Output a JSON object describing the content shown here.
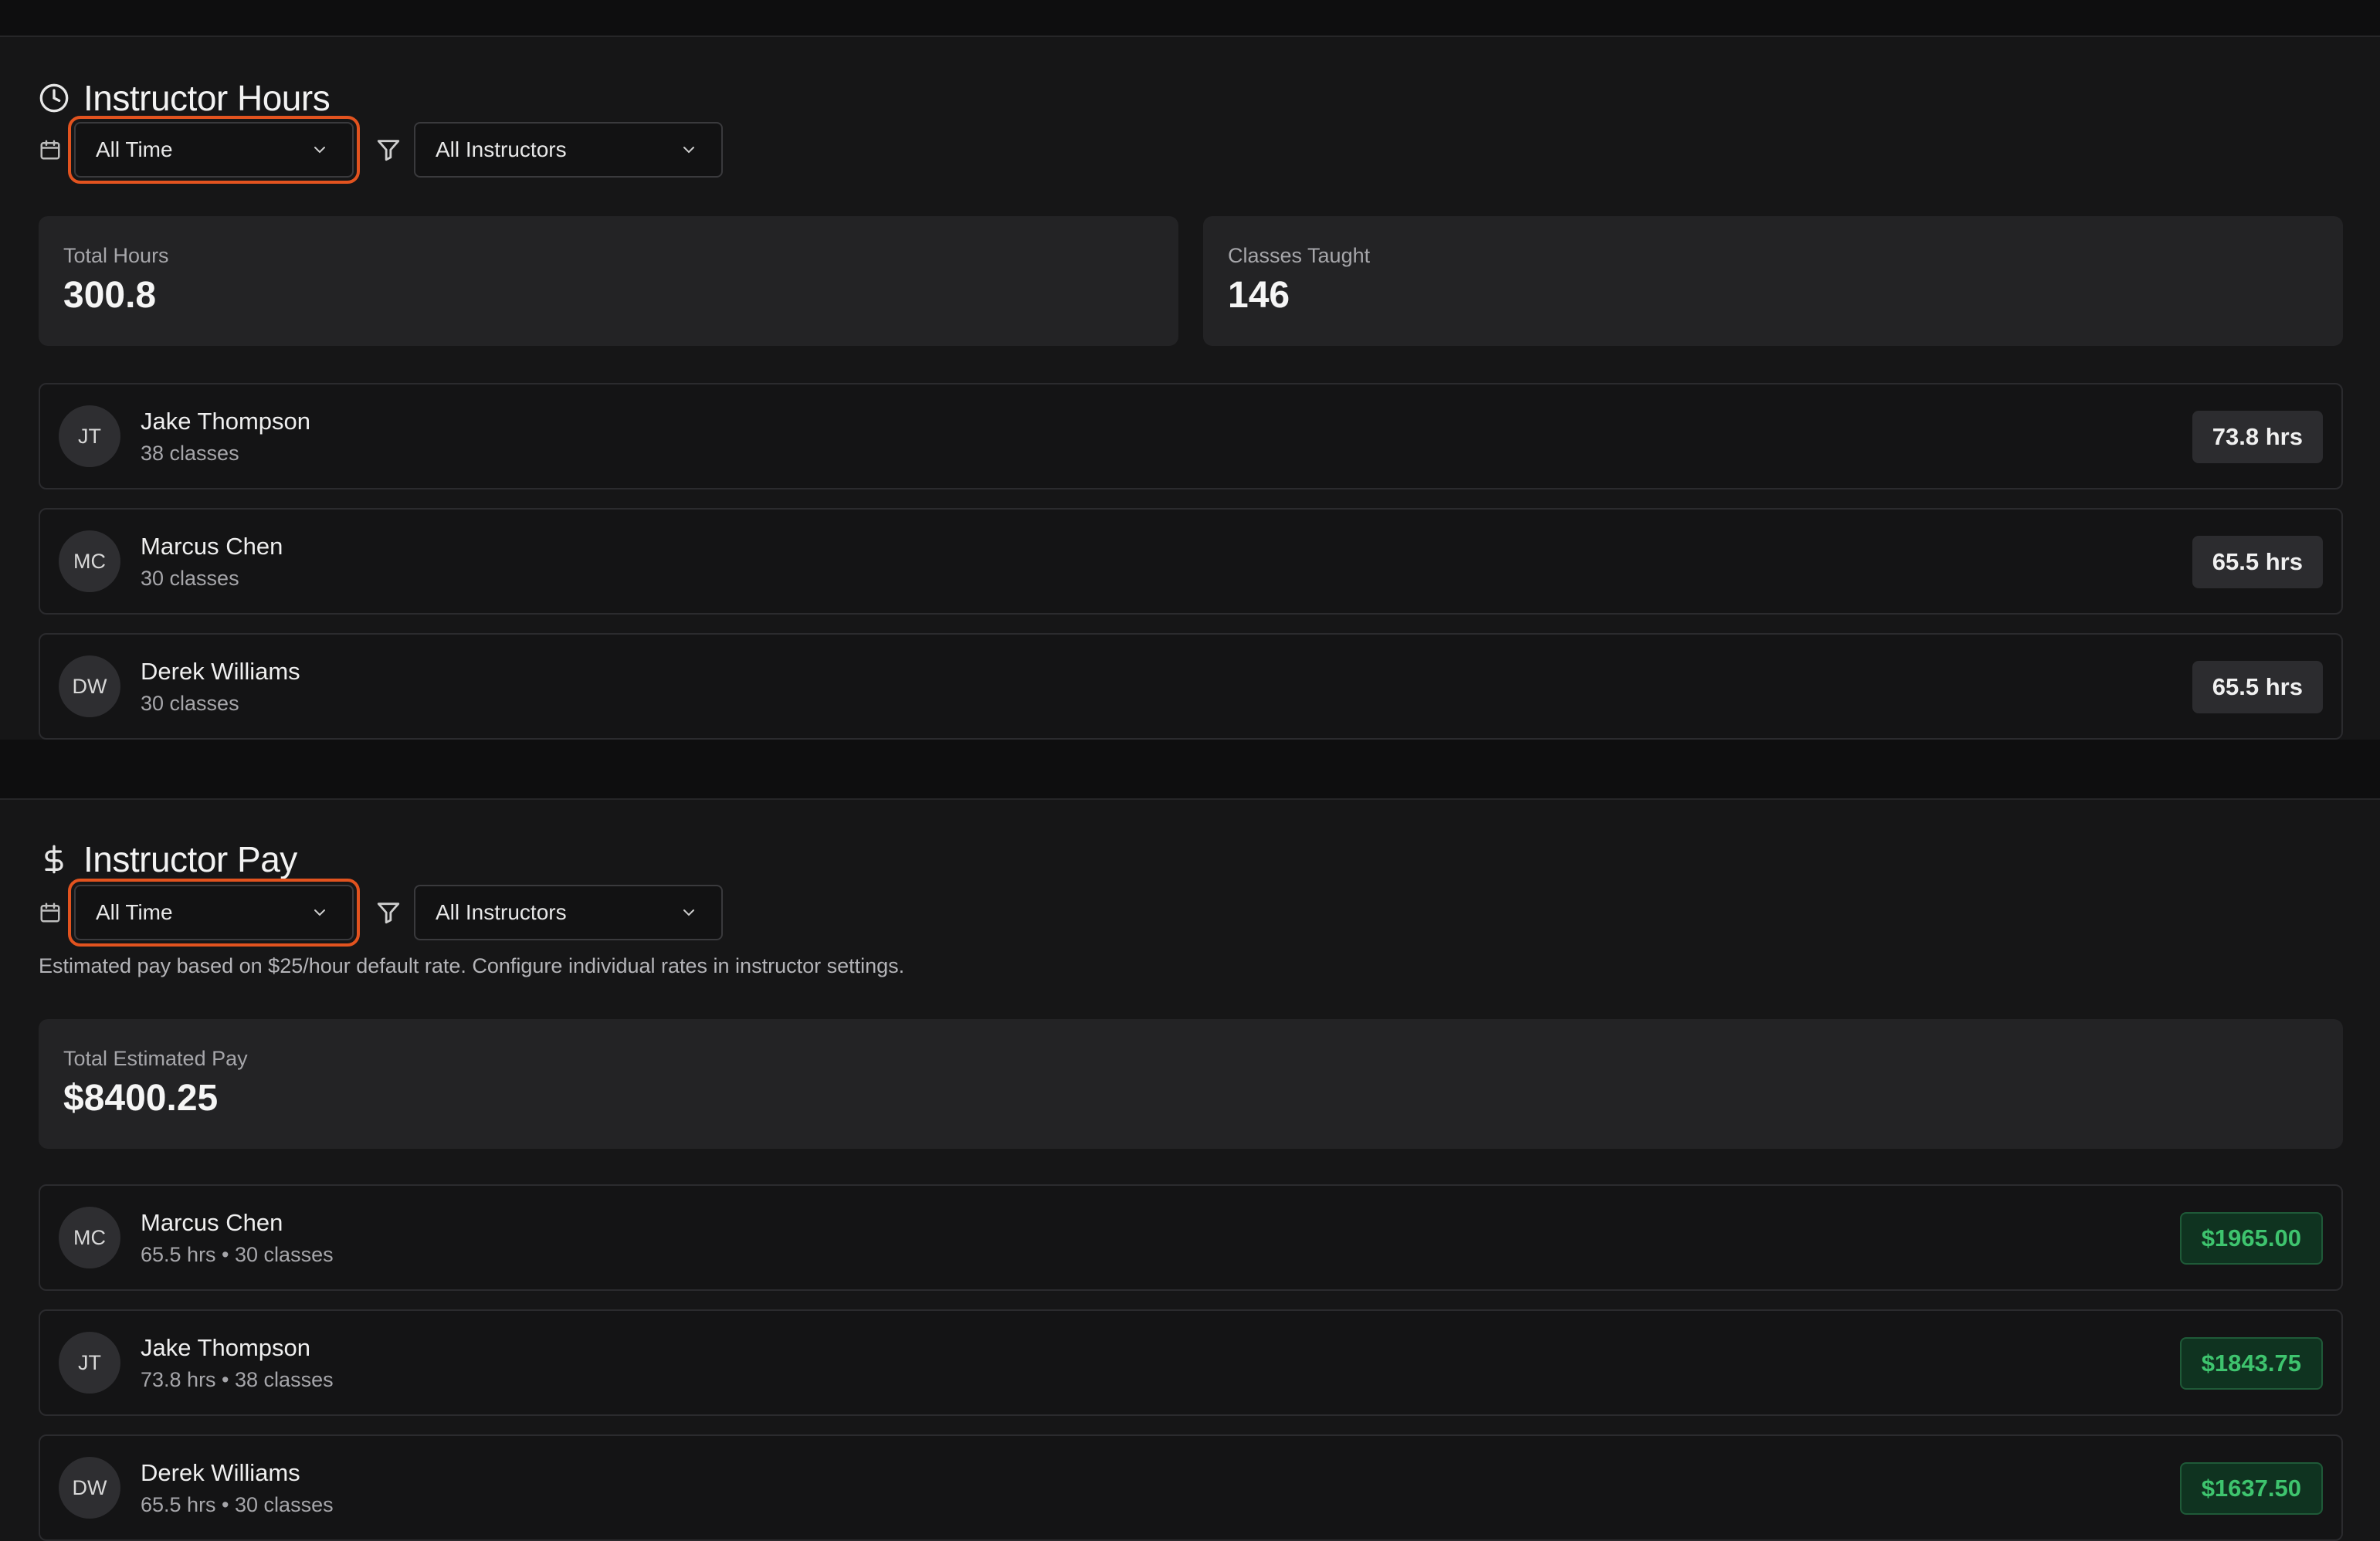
{
  "hours": {
    "title": "Instructor Hours",
    "icon": "clock-icon",
    "time_filter": "All Time",
    "instructor_filter": "All Instructors",
    "stats": [
      {
        "label": "Total Hours",
        "value": "300.8"
      },
      {
        "label": "Classes Taught",
        "value": "146"
      }
    ],
    "rows": [
      {
        "initials": "JT",
        "name": "Jake Thompson",
        "sub": "38 classes",
        "badge": "73.8 hrs"
      },
      {
        "initials": "MC",
        "name": "Marcus Chen",
        "sub": "30 classes",
        "badge": "65.5 hrs"
      },
      {
        "initials": "DW",
        "name": "Derek Williams",
        "sub": "30 classes",
        "badge": "65.5 hrs"
      }
    ]
  },
  "pay": {
    "title": "Instructor Pay",
    "icon": "dollar-icon",
    "time_filter": "All Time",
    "instructor_filter": "All Instructors",
    "note": "Estimated pay based on $25/hour default rate. Configure individual rates in instructor settings.",
    "stats": [
      {
        "label": "Total Estimated Pay",
        "value": "$8400.25"
      }
    ],
    "rows": [
      {
        "initials": "MC",
        "name": "Marcus Chen",
        "sub": "65.5 hrs • 30 classes",
        "badge": "$1965.00"
      },
      {
        "initials": "JT",
        "name": "Jake Thompson",
        "sub": "73.8 hrs • 38 classes",
        "badge": "$1843.75"
      },
      {
        "initials": "DW",
        "name": "Derek Williams",
        "sub": "65.5 hrs • 30 classes",
        "badge": "$1637.50"
      }
    ]
  },
  "colors": {
    "accent_focus": "#e2531f",
    "pay_green": "#3ec46e",
    "background": "#0e0e0f",
    "panel": "#161617"
  }
}
